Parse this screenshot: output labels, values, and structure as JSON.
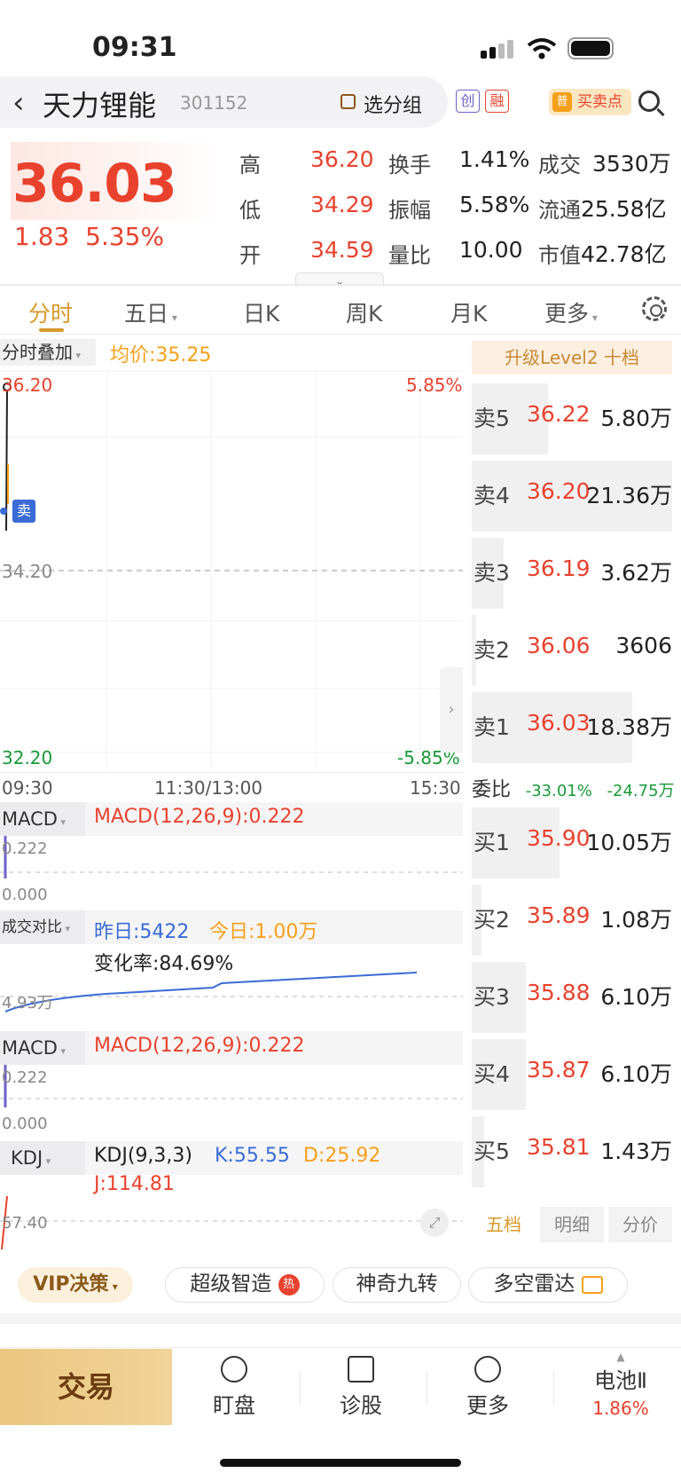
{
  "status_bar": {
    "time": "09:31"
  },
  "header": {
    "stock_name": "天力锂能",
    "stock_code": "301152",
    "group_button": "选分组",
    "tags": [
      "创",
      "融"
    ],
    "buysell_button": "买卖点",
    "buysell_badge": "普"
  },
  "quote": {
    "price": "36.03",
    "change": "1.83",
    "change_pct": "5.35%",
    "stats": [
      {
        "label": "高",
        "value": "36.20"
      },
      {
        "label": "低",
        "value": "34.29"
      },
      {
        "label": "开",
        "value": "34.59"
      },
      {
        "label": "换手",
        "value": "1.41%"
      },
      {
        "label": "振幅",
        "value": "5.58%"
      },
      {
        "label": "量比",
        "value": "10.00"
      },
      {
        "label": "成交",
        "value": "3530万"
      },
      {
        "label": "流通",
        "value": "25.58亿"
      },
      {
        "label": "市值",
        "value": "42.78亿"
      }
    ]
  },
  "tabs": [
    "分时",
    "五日",
    "日K",
    "周K",
    "月K",
    "更多"
  ],
  "chart": {
    "overlay_label": "分时叠加",
    "avg_label": "均价:35.25",
    "y_top": "36.20",
    "y_mid": "34.20",
    "y_bottom": "32.20",
    "pct_top": "5.85%",
    "pct_bottom": "-5.85%",
    "time_start": "09:30",
    "time_mid": "11:30/13:00",
    "time_end": "15:30",
    "sell_marker": "卖"
  },
  "indicators": {
    "macd1": {
      "label": "MACD",
      "text": "MACD(12,26,9):0.222",
      "v_top": "0.222",
      "v_bottom": "0.000"
    },
    "volume_compare": {
      "label": "成交对比",
      "yesterday": "昨日:5422",
      "today": "今日:1.00万",
      "rate": "变化率:84.69%",
      "axis": "4.93万"
    },
    "macd2": {
      "label": "MACD",
      "text": "MACD(12,26,9):0.222",
      "v_top": "0.222",
      "v_bottom": "0.000"
    },
    "kdj": {
      "label": "KDJ",
      "name": "KDJ(9,3,3)",
      "k": "K:55.55",
      "d": "D:25.92",
      "j": "J:114.81",
      "axis": "57.40"
    }
  },
  "order_book": {
    "banner": "升级Level2 十档",
    "asks": [
      {
        "label": "卖5",
        "price": "36.22",
        "volume": "5.80万",
        "depth": 0.38
      },
      {
        "label": "卖4",
        "price": "36.20",
        "volume": "21.36万",
        "depth": 1.0
      },
      {
        "label": "卖3",
        "price": "36.19",
        "volume": "3.62万",
        "depth": 0.16
      },
      {
        "label": "卖2",
        "price": "36.06",
        "volume": "3606",
        "depth": 0.02
      },
      {
        "label": "卖1",
        "price": "36.03",
        "volume": "18.38万",
        "depth": 0.8
      }
    ],
    "weibi_label": "委比",
    "weibi_pct": "-33.01%",
    "weibi_vol": "-24.75万",
    "bids": [
      {
        "label": "买1",
        "price": "35.90",
        "volume": "10.05万",
        "depth": 0.44
      },
      {
        "label": "买2",
        "price": "35.89",
        "volume": "1.08万",
        "depth": 0.05
      },
      {
        "label": "买3",
        "price": "35.88",
        "volume": "6.10万",
        "depth": 0.27
      },
      {
        "label": "买4",
        "price": "35.87",
        "volume": "6.10万",
        "depth": 0.27
      },
      {
        "label": "买5",
        "price": "35.81",
        "volume": "1.43万",
        "depth": 0.06
      }
    ],
    "tabs": [
      "五档",
      "明细",
      "分价"
    ]
  },
  "features": {
    "vip": "VIP决策",
    "chips": [
      "超级智造",
      "神奇九转",
      "多空雷达"
    ],
    "hot_badge": "热"
  },
  "bottom_nav": {
    "trade": "交易",
    "items": [
      "盯盘",
      "诊股",
      "更多"
    ],
    "sector_name": "电池Ⅱ",
    "sector_change": "1.86%"
  },
  "colors": {
    "up": "#e8422e",
    "down": "#1a9a3a",
    "accent": "#d89a2a",
    "line": "#3b6bd6"
  }
}
